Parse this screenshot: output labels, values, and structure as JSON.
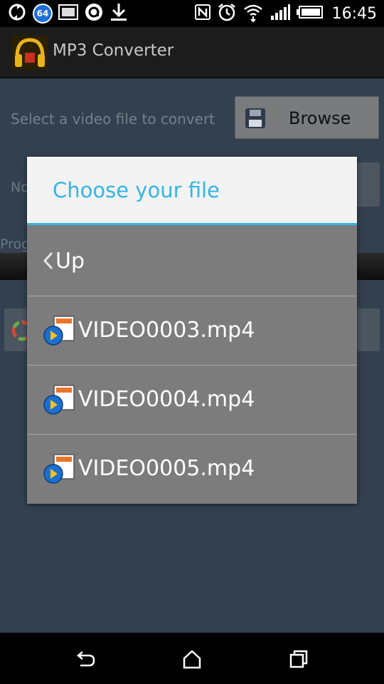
{
  "status_bar": {
    "time": "16:45",
    "left_icons": [
      "sync-icon",
      "badge-64-icon",
      "image-icon",
      "at-icon",
      "download-icon"
    ],
    "badge_text": "64",
    "right_icons": [
      "nfc-icon",
      "alarm-icon",
      "wifi-icon",
      "signal-icon",
      "battery-icon"
    ]
  },
  "app": {
    "title": "MP3 Converter",
    "logo_icon": "headphones-icon"
  },
  "background": {
    "select_label": "Select a video file to convert",
    "browse_label": "Browse",
    "no_file_label": "No",
    "progress_label": "Prog"
  },
  "dialog": {
    "title": "Choose your file",
    "up_label": "Up",
    "files": [
      {
        "name": "VIDEO0003.mp4"
      },
      {
        "name": "VIDEO0004.mp4"
      },
      {
        "name": "VIDEO0005.mp4"
      }
    ]
  },
  "nav_bar": {
    "buttons": [
      "back-icon",
      "home-icon",
      "recent-apps-icon"
    ]
  },
  "colors": {
    "accent": "#33b5e5",
    "dialog_bg": "#7c7c7c",
    "content_bg": "#33404f"
  }
}
